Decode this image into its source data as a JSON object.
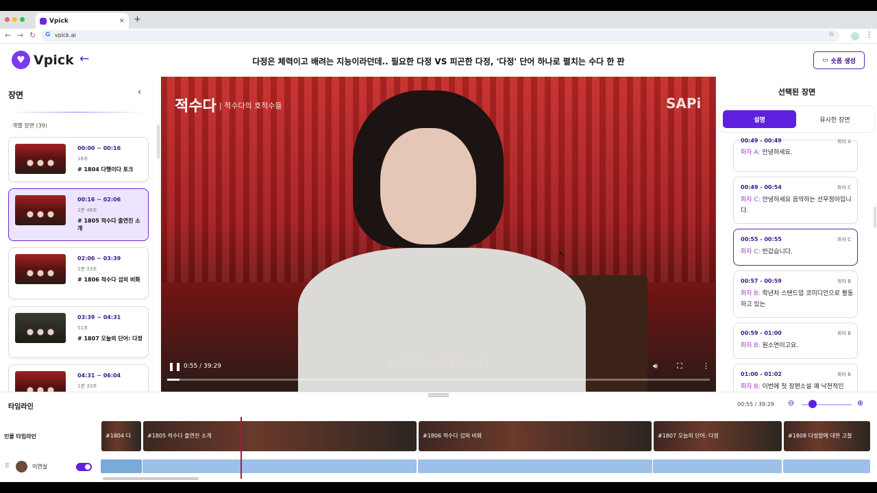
{
  "browser": {
    "tab_title": "Vpick",
    "tab_close": "×",
    "new_tab": "+",
    "url": "vpick.ai"
  },
  "header": {
    "logo_text": "Vpick",
    "title": "다정은 체력이고 배려는 지능이라던데.. 필요한 다정 VS 피곤한 다정, '다정' 단어 하나로 펼치는 수다 한 판",
    "shorts_button": "숏폼 생성"
  },
  "left_panel": {
    "title": "장면",
    "count_label": "개별 장면 (39)",
    "scenes": [
      {
        "time": "00:00 ~ 00:16",
        "duration": "16초",
        "name": "# 1804 다행이다 토크"
      },
      {
        "time": "00:16 ~ 02:06",
        "duration": "1분 49초",
        "name": "# 1805 적수다 출연진 소개"
      },
      {
        "time": "02:06 ~ 03:39",
        "duration": "1분 33초",
        "name": "# 1806 적수다 섭외 비화"
      },
      {
        "time": "03:39 ~ 04:31",
        "duration": "51초",
        "name": "# 1807 오늘의 단어: 다정"
      },
      {
        "time": "04:31 ~ 06:04",
        "duration": "1분 33초",
        "name": ""
      }
    ]
  },
  "video": {
    "channel_logo": "적수다",
    "channel_sub": "| 적수다의 호적수들",
    "brand": "SAPi",
    "subtitle": "선우정아  |  반갑습니다",
    "time_display": "0:55 / 39:29",
    "progress": 0.023
  },
  "right_panel": {
    "title": "선택된 장면",
    "tab_description": "설명",
    "tab_similar": "유사한 장면",
    "cards": [
      {
        "time": "00:49 - 00:49",
        "speaker": "화자 A",
        "label": "화자 A:",
        "text": " 안녕하세요."
      },
      {
        "time": "00:49 - 00:54",
        "speaker": "화자 C",
        "label": "화자 C:",
        "text": " 안녕하세요 음악하는 선우정아입니다."
      },
      {
        "time": "00:55 - 00:55",
        "speaker": "화자 C",
        "label": "화자 C:",
        "text": " 반갑습니다."
      },
      {
        "time": "00:57 - 00:59",
        "speaker": "화자 B",
        "label": "화자 B:",
        "text": " 학년차 스탠드업 코미디언으로 활동하고 있는"
      },
      {
        "time": "00:59 - 01:00",
        "speaker": "화자 B",
        "label": "화자 B:",
        "text": " 원소연이고요."
      },
      {
        "time": "01:00 - 01:02",
        "speaker": "화자 B",
        "label": "화자 B:",
        "text": " 이번에 첫 장편소설 꽤 낙천적인"
      }
    ]
  },
  "timeline": {
    "title": "타임라인",
    "time": "00:55 / 39:29",
    "row_label": "인물 타임라인",
    "clips": [
      "#1804 다",
      "#1805 적수다 출연진 소개",
      "#1806 적수다 섭외 비화",
      "#1807 오늘의 단어: 다정",
      "#1808 다정함에 대한 고찰"
    ],
    "person": {
      "name": "이연실",
      "visible": true
    }
  },
  "colors": {
    "accent": "#6020e0",
    "accent_dark": "#3b1a87",
    "speaker_label": "#a63bd0",
    "playhead": "#b3123d"
  }
}
